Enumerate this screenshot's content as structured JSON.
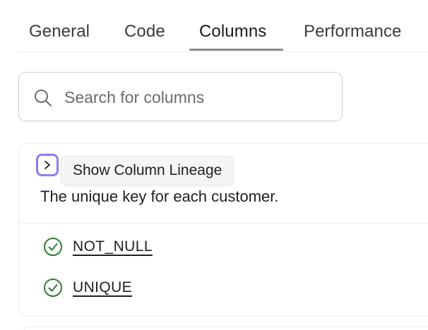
{
  "tabs": [
    {
      "label": "General"
    },
    {
      "label": "Code"
    },
    {
      "label": "Columns"
    },
    {
      "label": "Performance"
    }
  ],
  "active_tab": "Columns",
  "search": {
    "placeholder": "Search for columns",
    "value": ""
  },
  "column_card": {
    "expand_icon": "chevron-right-icon",
    "tooltip": "Show Column Lineage",
    "description": "The unique key for each customer.",
    "tests": [
      {
        "name": "NOT_NULL",
        "status_icon": "check-circle-icon",
        "status_color": "#2e7d32"
      },
      {
        "name": "UNIQUE",
        "status_icon": "check-circle-icon",
        "status_color": "#2e7d32"
      }
    ]
  },
  "colors": {
    "focus_ring": "#8b7cf6",
    "success": "#2e7d32"
  }
}
